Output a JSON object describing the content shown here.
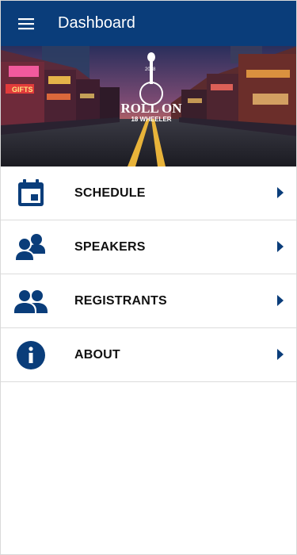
{
  "header": {
    "title": "Dashboard",
    "menu_icon": "hamburger-menu-icon",
    "background": "#0a3d7a"
  },
  "hero": {
    "logo_line1": "ROLL ON",
    "logo_line2": "18 WHEELER",
    "logo_year": "2018",
    "sign_text": "GIFTS"
  },
  "menu": {
    "items": [
      {
        "label": "SCHEDULE",
        "icon": "calendar-icon"
      },
      {
        "label": "SPEAKERS",
        "icon": "speakers-icon"
      },
      {
        "label": "REGISTRANTS",
        "icon": "people-icon"
      },
      {
        "label": "ABOUT",
        "icon": "info-icon"
      }
    ]
  },
  "colors": {
    "accent": "#0a3d7a",
    "divider": "#dcdcdc"
  }
}
